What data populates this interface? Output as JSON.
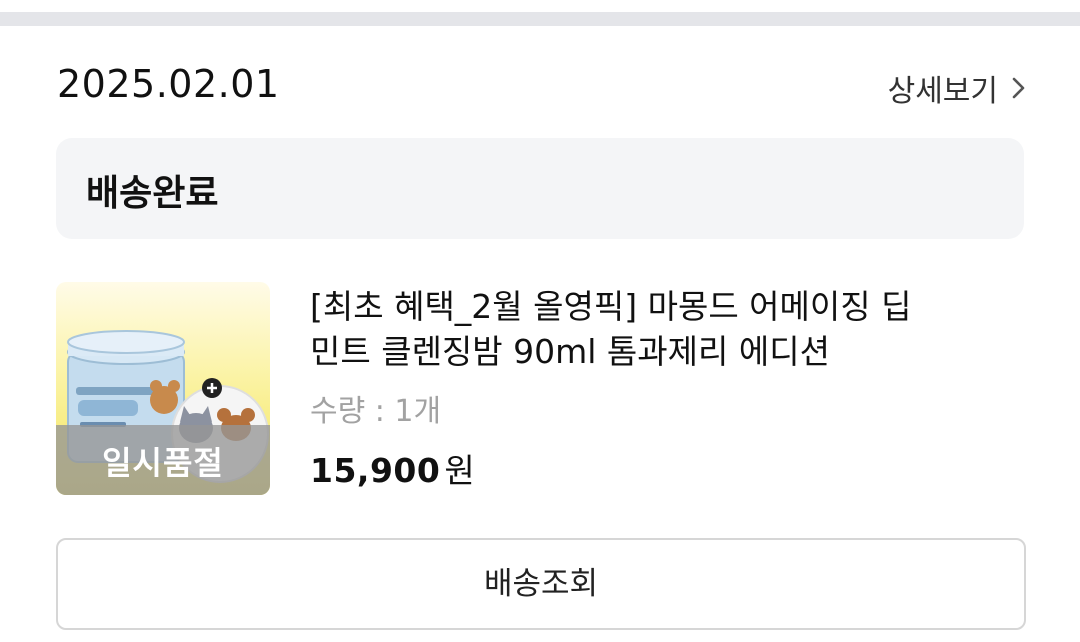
{
  "order": {
    "date": "2025.02.01",
    "detail_link_label": "상세보기",
    "status": "배송완료"
  },
  "product": {
    "name": "[최초 혜택_2월 올영픽] 마몽드 어메이징 딥 민트 클렌징밤 90ml 톰과제리 에디션",
    "quantity_text": "수량 : 1개",
    "price_amount": "15,900",
    "price_unit": "원",
    "sold_out_label": "일시품절",
    "image_colors": {
      "background": "#f7ec7a",
      "jar": "#b9d3e6",
      "overlay": "#969696"
    }
  },
  "actions": {
    "tracking_button_label": "배송조회"
  }
}
